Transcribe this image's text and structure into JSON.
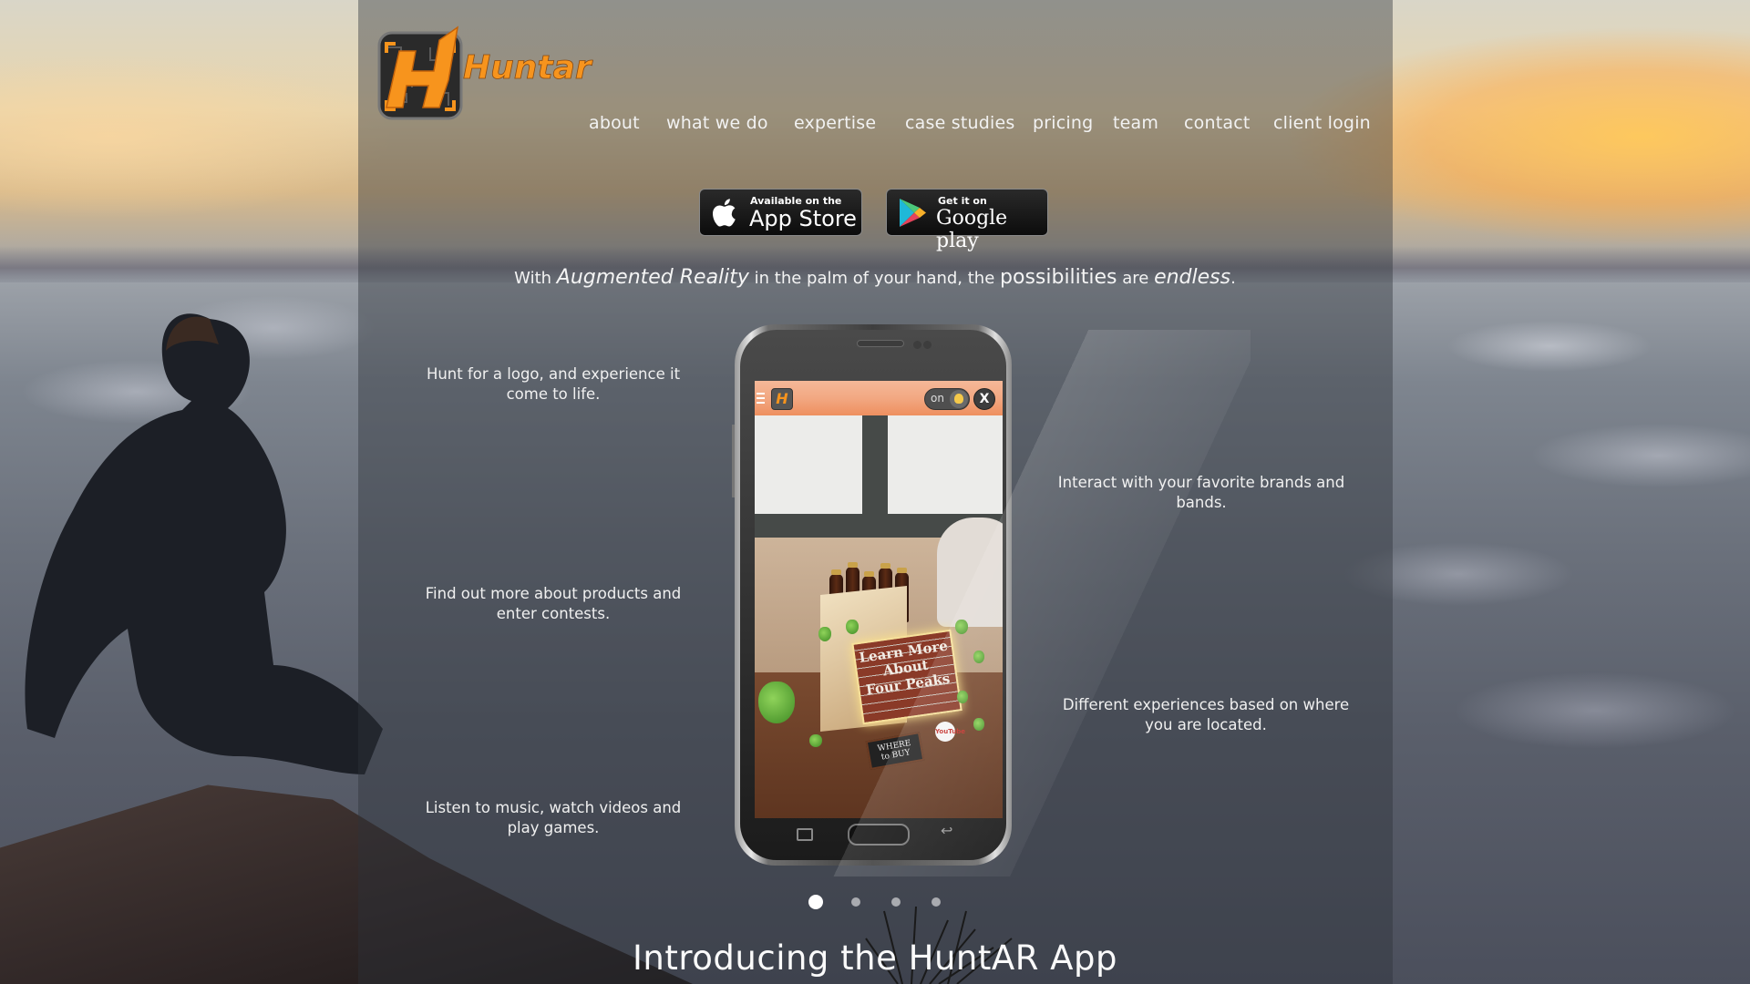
{
  "brand": {
    "name": "Huntar",
    "logo_letter": "H",
    "accent_color": "#f7941d"
  },
  "nav": {
    "items": [
      {
        "label": "about"
      },
      {
        "label": "what we do"
      },
      {
        "label": "expertise"
      },
      {
        "label": "case studies"
      },
      {
        "label": "pricing"
      },
      {
        "label": "team"
      },
      {
        "label": "contact"
      },
      {
        "label": "client login"
      }
    ]
  },
  "store_buttons": {
    "app_store": {
      "small": "Available on the",
      "big": "App Store",
      "icon": "apple-icon"
    },
    "google_play": {
      "small": "Get it on",
      "big": "Google play",
      "icon": "google-play-icon"
    }
  },
  "tagline": {
    "part1": "With ",
    "part2": "Augmented Reality",
    "part3": " in the palm of your hand, the ",
    "part4": "possibilities",
    "part5": " are ",
    "part6": "endless",
    "part7": "."
  },
  "features": {
    "left": [
      "Hunt for a logo, and experience it come to life.",
      "Find out more about products and enter contests.",
      "Listen to music, watch videos and play games."
    ],
    "right": [
      "Interact with your favorite brands and bands.",
      "Different experiences based on where you are located."
    ]
  },
  "phone_app": {
    "toggle_label": "on",
    "close_label": "X",
    "logo_letter": "H",
    "sign_text": [
      "Learn More",
      "About",
      "Four Peaks"
    ],
    "where_buy": [
      "WHERE",
      "to BUY"
    ],
    "youtube": "YouTube"
  },
  "carousel": {
    "total": 4,
    "active_index": 0
  },
  "intro_heading": "Introducing the HuntAR App"
}
